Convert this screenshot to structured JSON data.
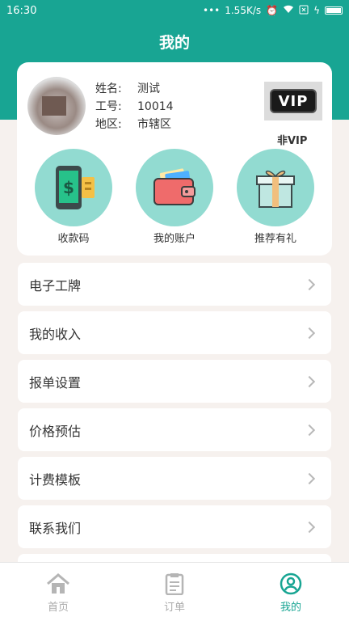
{
  "status_bar": {
    "time": "16:30",
    "network_speed": "1.55K/s",
    "icons": [
      "dots-icon",
      "alarm-icon",
      "wifi-icon",
      "sim-icon",
      "charging-icon",
      "battery-icon"
    ]
  },
  "header": {
    "title": "我的"
  },
  "profile": {
    "name_label": "姓名:",
    "name_value": "测试",
    "id_label": "工号:",
    "id_value": "10014",
    "region_label": "地区:",
    "region_value": "市辖区",
    "vip_badge": "VIP",
    "vip_status": "非VIP"
  },
  "quick_actions": [
    {
      "label": "收款码",
      "icon": "payment-code-icon"
    },
    {
      "label": "我的账户",
      "icon": "wallet-icon"
    },
    {
      "label": "推荐有礼",
      "icon": "gift-icon"
    }
  ],
  "menu": [
    {
      "label": "电子工牌"
    },
    {
      "label": "我的收入"
    },
    {
      "label": "报单设置"
    },
    {
      "label": "价格预估"
    },
    {
      "label": "计费模板"
    },
    {
      "label": "联系我们"
    }
  ],
  "tabs": [
    {
      "label": "首页",
      "icon": "home-icon",
      "active": false
    },
    {
      "label": "订单",
      "icon": "clipboard-icon",
      "active": false
    },
    {
      "label": "我的",
      "icon": "user-icon",
      "active": true
    }
  ],
  "colors": {
    "primary": "#18a593",
    "icon_bg": "#92dbd1",
    "background": "#f6f1ee"
  }
}
